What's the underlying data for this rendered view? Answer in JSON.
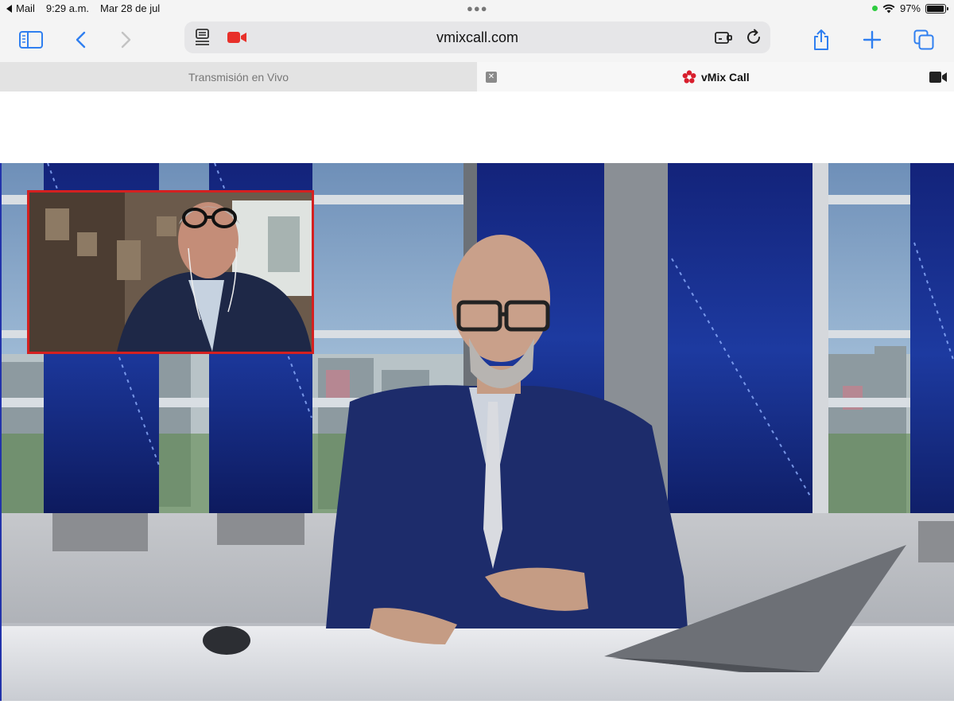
{
  "status_bar": {
    "back_app": "Mail",
    "time": "9:29 a.m.",
    "date": "Mar 28 de jul",
    "battery": "97%",
    "battery_level": 0.97
  },
  "toolbar": {
    "url": "vmixcall.com",
    "icons": [
      "sidebar-icon",
      "back-icon",
      "forward-icon",
      "reader-icon",
      "camera-recording-icon",
      "extension-icon",
      "reload-icon",
      "share-icon",
      "new-tab-icon",
      "tab-overview-icon"
    ]
  },
  "tabs": [
    {
      "title": "Transmisión en Vivo",
      "active": false
    },
    {
      "title": "vMix Call",
      "active": true
    }
  ],
  "colors": {
    "recording": "#e8302a",
    "pip_border": "#d42020",
    "brand": "#d81e2c"
  }
}
